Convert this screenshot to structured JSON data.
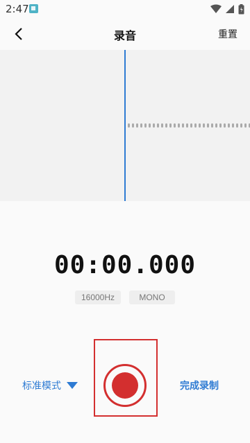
{
  "status_bar": {
    "time": "2:47",
    "icons": [
      "app-notification-icon",
      "wifi-icon",
      "cell-signal-icon",
      "battery-icon"
    ]
  },
  "header": {
    "title": "录音",
    "reset_label": "重置"
  },
  "recorder": {
    "elapsed": "00:00.000",
    "sample_rate": "16000Hz",
    "channel": "MONO"
  },
  "controls": {
    "mode_label": "标准模式",
    "finish_label": "完成录制"
  },
  "colors": {
    "accent": "#2e7bd3",
    "record": "#d32f2f",
    "waveform_bg": "#f2f2f2"
  }
}
